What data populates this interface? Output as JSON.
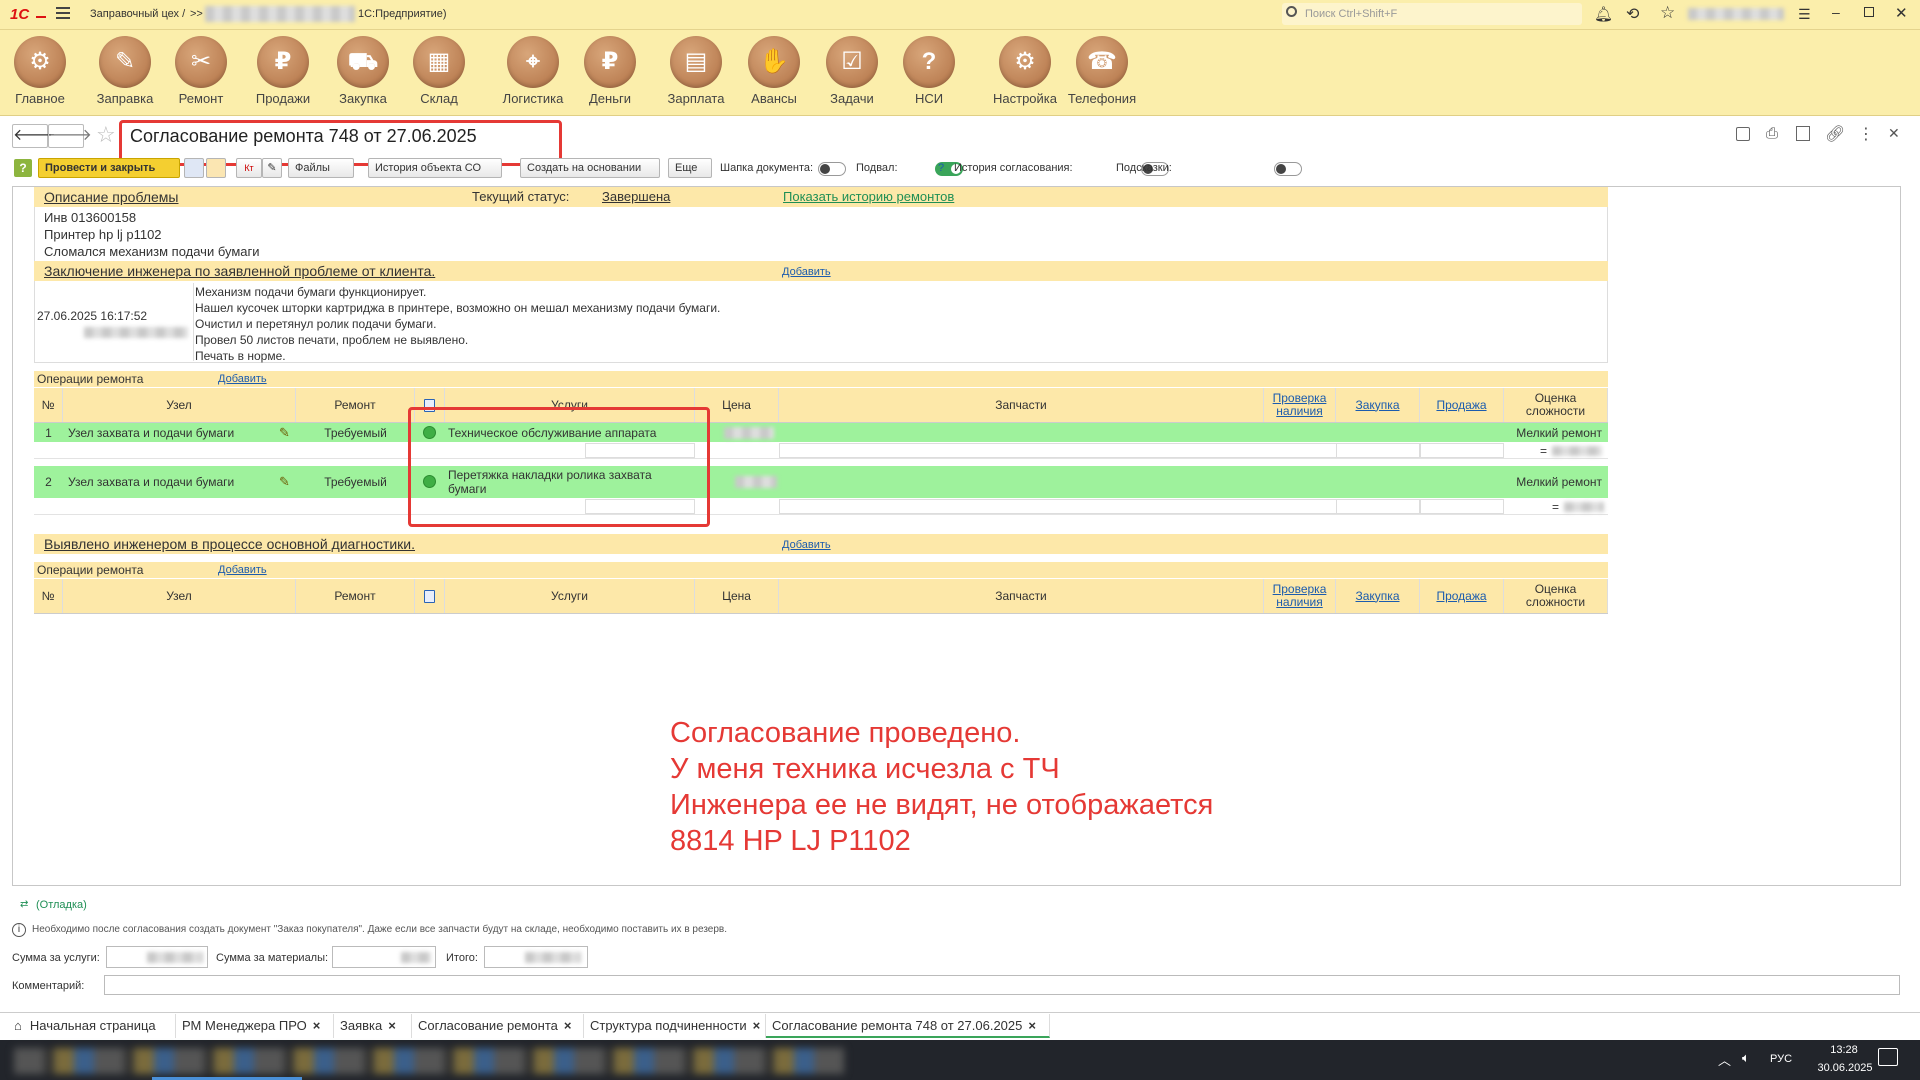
{
  "topbar": {
    "app_name": "Заправочный цех /",
    "breadcrumb_sep": ">>",
    "platform": "1С:Предприятие)",
    "search_placeholder": "Поиск Ctrl+Shift+F"
  },
  "sections": [
    {
      "label": "Главное",
      "icon": "gears-icon",
      "glyph": "⚙"
    },
    {
      "label": "Заправка",
      "icon": "printer-refill-icon",
      "glyph": "✎"
    },
    {
      "label": "Ремонт",
      "icon": "tools-icon",
      "glyph": "✂"
    },
    {
      "label": "Продажи",
      "icon": "sale-icon",
      "glyph": "₽"
    },
    {
      "label": "Закупка",
      "icon": "cart-icon",
      "glyph": "⛟"
    },
    {
      "label": "Склад",
      "icon": "warehouse-icon",
      "glyph": "▦"
    },
    {
      "label": "Логистика",
      "icon": "map-icon",
      "glyph": "⌖"
    },
    {
      "label": "Деньги",
      "icon": "money-bag-icon",
      "glyph": "₽"
    },
    {
      "label": "Зарплата",
      "icon": "wallet-icon",
      "glyph": "▤"
    },
    {
      "label": "Авансы",
      "icon": "hand-coin-icon",
      "glyph": "✋"
    },
    {
      "label": "Задачи",
      "icon": "tasks-icon",
      "glyph": "☑"
    },
    {
      "label": "НСИ",
      "icon": "reference-icon",
      "glyph": "?"
    },
    {
      "label": "Настройка",
      "icon": "settings-icon",
      "glyph": "⚙"
    },
    {
      "label": "Телефония",
      "icon": "phone-icon",
      "glyph": "☎"
    }
  ],
  "document": {
    "title": "Согласование ремонта 748 от 27.06.2025"
  },
  "toolbar": {
    "post_close": "Провести и закрыть",
    "files": "Файлы",
    "history_co": "История объекта СО",
    "create_based": "Создать на основании",
    "more": "Еще",
    "header_label": "Шапка документа:",
    "footer_label": "Подвал:",
    "help_q": "?",
    "approval_history": "История согласования:",
    "hints": "Подсказки:"
  },
  "problem": {
    "section_title": "Описание проблемы",
    "status_label": "Текущий статус:",
    "status_value": "Завершена",
    "history_link": "Показать историю ремонтов",
    "lines": [
      "Инв 013600158",
      "Принтер hp lj p1102",
      "Сломался механизм подачи бумаги"
    ]
  },
  "conclusion": {
    "section_title": "Заключение инженера по заявленной проблеме от клиента.",
    "add_link": "Добавить",
    "datetime": "27.06.2025 16:17:52",
    "lines": [
      "Механизм подачи бумаги функционирует.",
      "Нашел кусочек шторки картриджа в принтере, возможно он мешал механизму подачи бумаги.",
      "Очистил и перетянул ролик подачи бумаги.",
      "Провел 50 листов печати, проблем не выявлено.",
      "Печать в норме."
    ]
  },
  "ops1": {
    "title": "Операции ремонта",
    "add_link": "Добавить",
    "headers": {
      "num": "№",
      "node": "Узел",
      "repair": "Ремонт",
      "services": "Услуги",
      "price": "Цена",
      "parts": "Запчасти",
      "check": "Проверка наличия",
      "purchase": "Закупка",
      "sale": "Продажа",
      "complexity": "Оценка сложности"
    },
    "rows": [
      {
        "num": "1",
        "node": "Узел захвата и подачи бумаги",
        "repair": "Требуемый",
        "service": "Техническое обслуживание аппарата",
        "complexity": "Мелкий ремонт",
        "eq": "="
      },
      {
        "num": "2",
        "node": "Узел захвата и подачи бумаги",
        "repair": "Требуемый",
        "service": "Перетяжка накладки ролика захвата бумаги",
        "complexity": "Мелкий ремонт",
        "eq": "="
      }
    ]
  },
  "found": {
    "section_title": "Выявлено инженером в процессе основной диагностики.",
    "add_link": "Добавить"
  },
  "ops2": {
    "title": "Операции ремонта",
    "add_link": "Добавить"
  },
  "annotation": {
    "lines": [
      "Согласование проведено.",
      "У меня техника исчезла с ТЧ",
      "Инженера ее не видят, не отображается",
      "8814 HP LJ P1102"
    ],
    "color": "#e53935"
  },
  "footer": {
    "debug": "(Отладка)",
    "info": "Необходимо после согласования создать документ \"Заказ покупателя\". Даже если все запчасти будут на складе, необходимо поставить их в резерв.",
    "sum_services": "Сумма за услуги:",
    "sum_materials": "Сумма за материалы:",
    "total": "Итого:",
    "comment": "Комментарий:"
  },
  "tabs": [
    {
      "label": "Начальная страница",
      "icon": "home-icon"
    },
    {
      "label": "РМ Менеджера ПРО"
    },
    {
      "label": "Заявка"
    },
    {
      "label": "Согласование ремонта"
    },
    {
      "label": "Структура подчиненности"
    },
    {
      "label": "Согласование ремонта 748 от 27.06.2025"
    }
  ],
  "taskbar": {
    "lang": "РУС",
    "time": "13:28",
    "date": "30.06.2025"
  }
}
